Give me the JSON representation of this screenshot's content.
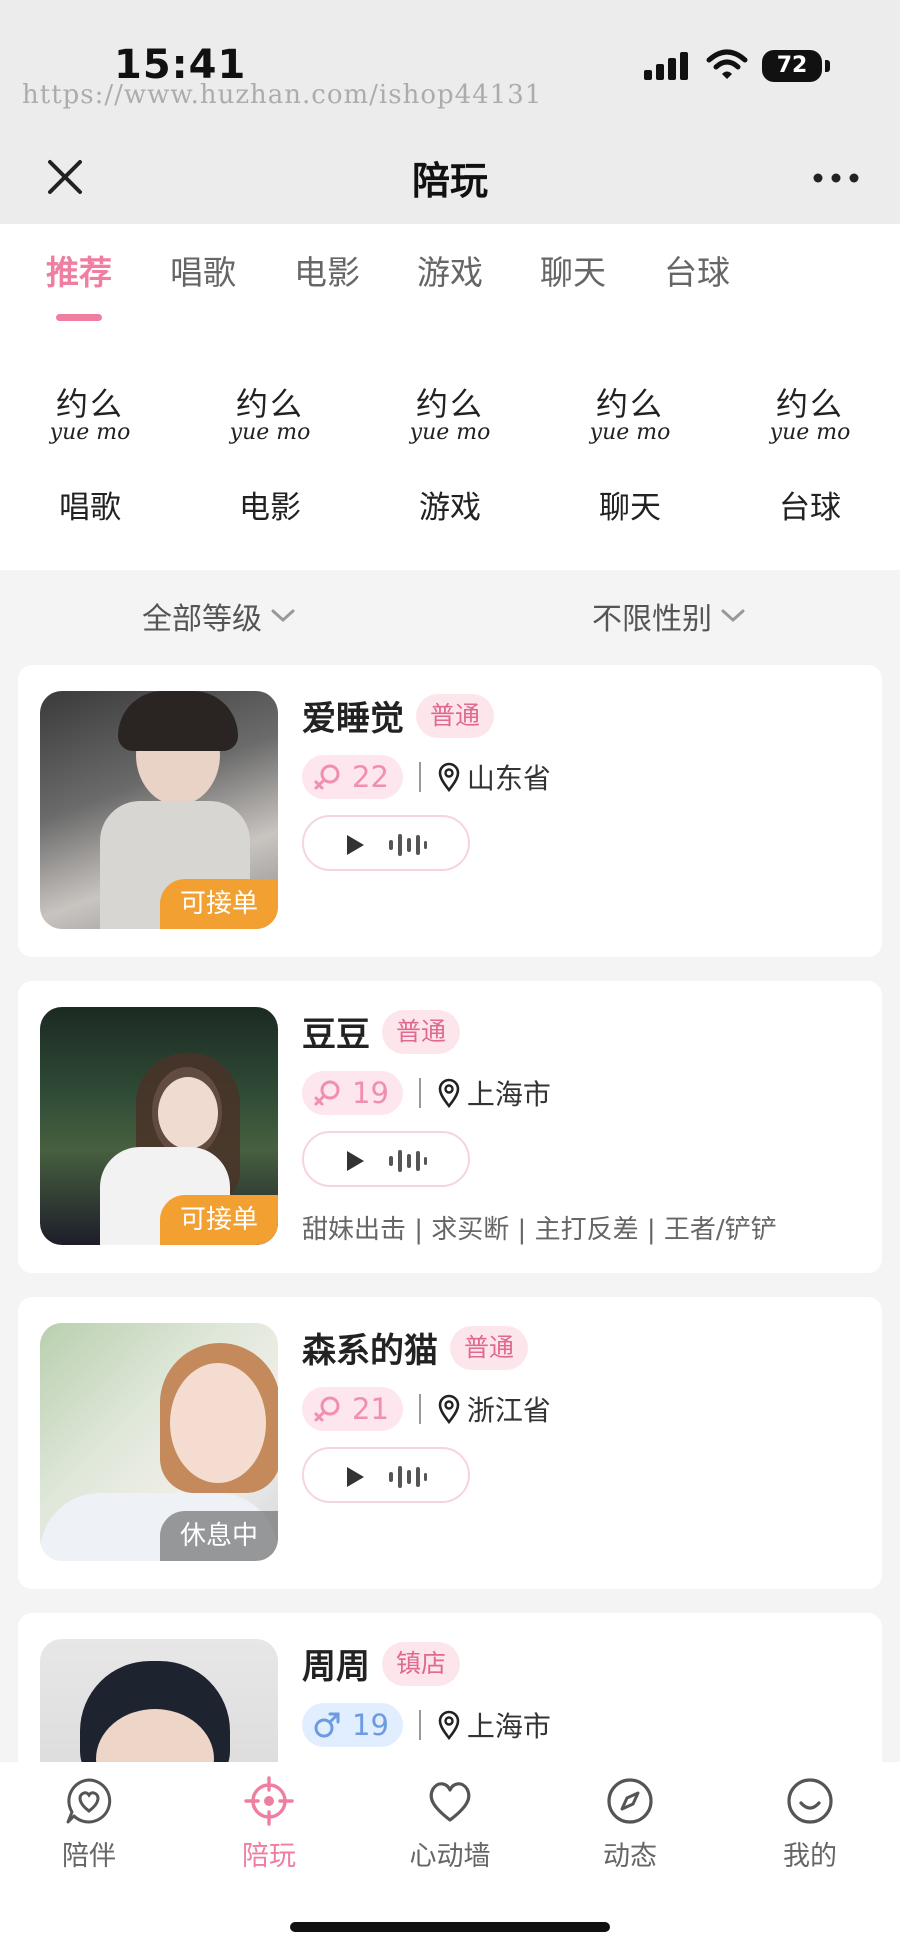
{
  "status_bar": {
    "time": "15:41",
    "watermark": "https://www.huzhan.com/ishop44131",
    "battery": "72",
    "icons": [
      "signal-icon",
      "wifi-icon",
      "battery-icon"
    ]
  },
  "nav": {
    "title": "陪玩",
    "left_icon": "close-icon",
    "right_icon": "more-icon"
  },
  "tabs": [
    {
      "label": "推荐",
      "active": true
    },
    {
      "label": "唱歌",
      "active": false
    },
    {
      "label": "电影",
      "active": false
    },
    {
      "label": "游戏",
      "active": false
    },
    {
      "label": "聊天",
      "active": false
    },
    {
      "label": "台球",
      "active": false
    }
  ],
  "categories": [
    {
      "logo_cn": "约么",
      "logo_py": "yue mo",
      "label": "唱歌"
    },
    {
      "logo_cn": "约么",
      "logo_py": "yue mo",
      "label": "电影"
    },
    {
      "logo_cn": "约么",
      "logo_py": "yue mo",
      "label": "游戏"
    },
    {
      "logo_cn": "约么",
      "logo_py": "yue mo",
      "label": "聊天"
    },
    {
      "logo_cn": "约么",
      "logo_py": "yue mo",
      "label": "台球"
    }
  ],
  "filters": {
    "level": "全部等级",
    "gender": "不限性别"
  },
  "companions": [
    {
      "name": "爱睡觉",
      "level": "普通",
      "gender": "female",
      "age": "22",
      "location": "山东省",
      "status": "可接单",
      "tags": ""
    },
    {
      "name": "豆豆",
      "level": "普通",
      "gender": "female",
      "age": "19",
      "location": "上海市",
      "status": "可接单",
      "tags": "甜妹出击 | 求买断 | 主打反差 | 王者/铲铲"
    },
    {
      "name": "森系的猫",
      "level": "普通",
      "gender": "female",
      "age": "21",
      "location": "浙江省",
      "status": "休息中",
      "tags": ""
    },
    {
      "name": "周周",
      "level": "镇店",
      "gender": "male",
      "age": "19",
      "location": "上海市",
      "status": "",
      "tags": ""
    }
  ],
  "bottom_nav": [
    {
      "label": "陪伴",
      "icon": "heart-chat-icon",
      "active": false
    },
    {
      "label": "陪玩",
      "icon": "crosshair-icon",
      "active": true
    },
    {
      "label": "心动墙",
      "icon": "heart-icon",
      "active": false
    },
    {
      "label": "动态",
      "icon": "compass-icon",
      "active": false
    },
    {
      "label": "我的",
      "icon": "smile-icon",
      "active": false
    }
  ],
  "colors": {
    "accent": "#f07ea0",
    "status_open": "#f3a033",
    "status_rest": "#8a8a8a",
    "female": "#f08fae",
    "male": "#6d9be0"
  }
}
